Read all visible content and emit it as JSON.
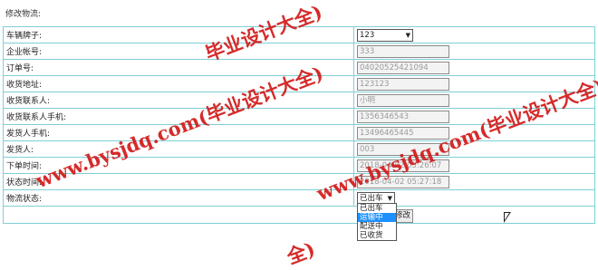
{
  "page": {
    "title": "修改物流:"
  },
  "form": {
    "rows": [
      {
        "label": "车辆牌子:",
        "type": "select",
        "value": "123"
      },
      {
        "label": "企业帐号:",
        "type": "input",
        "value": "333"
      },
      {
        "label": "订单号:",
        "type": "input",
        "value": "04020525421094"
      },
      {
        "label": "收货地址:",
        "type": "input",
        "value": "123123"
      },
      {
        "label": "收货联系人:",
        "type": "input",
        "value": "小明"
      },
      {
        "label": "收货联系人手机:",
        "type": "input",
        "value": "1356346543"
      },
      {
        "label": "发货人手机:",
        "type": "input",
        "value": "13496465445"
      },
      {
        "label": "发货人:",
        "type": "input",
        "value": "003"
      },
      {
        "label": "下单时间:",
        "type": "input",
        "value": "2018-04-02 05:26:07"
      },
      {
        "label": "状态时间:",
        "type": "input",
        "value": "2018-04-02 05:27:18"
      },
      {
        "label": "物流状态:",
        "type": "select",
        "value": "已出车"
      }
    ],
    "status_options": [
      "已出车",
      "运输中",
      "配送中",
      "已收货"
    ],
    "status_highlighted": "运输中",
    "submit_label": "修改"
  },
  "watermark": {
    "text": "www.bysjdq.com(毕业设计大全)",
    "fragment_left": "毕业设计大全)",
    "fragment_bottom": "全)",
    "color": "#d21a1a"
  }
}
